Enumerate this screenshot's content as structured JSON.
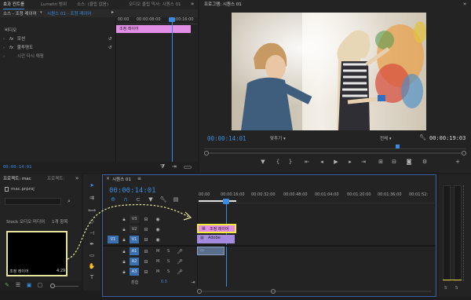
{
  "effect_controls": {
    "tabs": [
      "효과 컨트롤",
      "Lumetri 범위",
      "소스: (클립 없음)",
      "오디오 클립 믹서: 시퀀스 01"
    ],
    "source_label": "소스 - 조정 레이어",
    "sequence_label": "시퀀스 01 - 조정 레이어",
    "ruler": [
      "00:00",
      "00:00:08:00",
      "00:00:16:00"
    ],
    "clip_label": "조정 레이어",
    "section": "비디오",
    "effects": [
      "모션",
      "불투명도",
      "시간 다시 매핑"
    ],
    "timecode": "00:00:14:01"
  },
  "program": {
    "tab": "프로그램: 시퀀스 01",
    "timecode": "00:00:14:01",
    "fit": "맞추기",
    "quality": "전체",
    "duration": "00:00:19:03",
    "controls": [
      "marker-icon",
      "in-point-icon",
      "out-point-icon",
      "go-to-in-icon",
      "step-back-icon",
      "play-icon",
      "step-forward-icon",
      "go-to-out-icon",
      "insert-icon",
      "overwrite-icon",
      "export-frame-icon",
      "settings-icon",
      "add-icon"
    ]
  },
  "project": {
    "tab": "프로젝트: mac",
    "tab2": "프로젝트:",
    "file": "mac.prproj",
    "bin": "Stock 오디오 미디어",
    "item_count": "1개 항목",
    "clip_name": "조정 레이어",
    "clip_duration": "4:29"
  },
  "timeline": {
    "tab": "시퀀스 01",
    "timecode": "00:00:14:01",
    "ruler": [
      "00:00",
      "00:00:16:00",
      "00:00:32:00",
      "00:00:48:00",
      "00:01:04:00",
      "00:01:20:00",
      "00:01:36:00",
      "00:01:52:"
    ],
    "video_tracks": [
      "V3",
      "V2",
      "V1"
    ],
    "audio_tracks": [
      "A1",
      "A2",
      "A3"
    ],
    "source_patch": "V1",
    "mix_label": "혼합",
    "mix_value": "0.0",
    "adjust_clip": "조정 레이어",
    "video_clip": "Adobe",
    "mute_label": "M",
    "solo_label": "S"
  },
  "meter": {
    "labels": [
      "S",
      "S"
    ]
  },
  "colors": {
    "timecode": "#3b8be0",
    "adjust_clip": "#e38ee6",
    "video_clip": "#a58be0",
    "highlight": "#f4ea3a",
    "accent_blue": "#2d8ceb"
  }
}
